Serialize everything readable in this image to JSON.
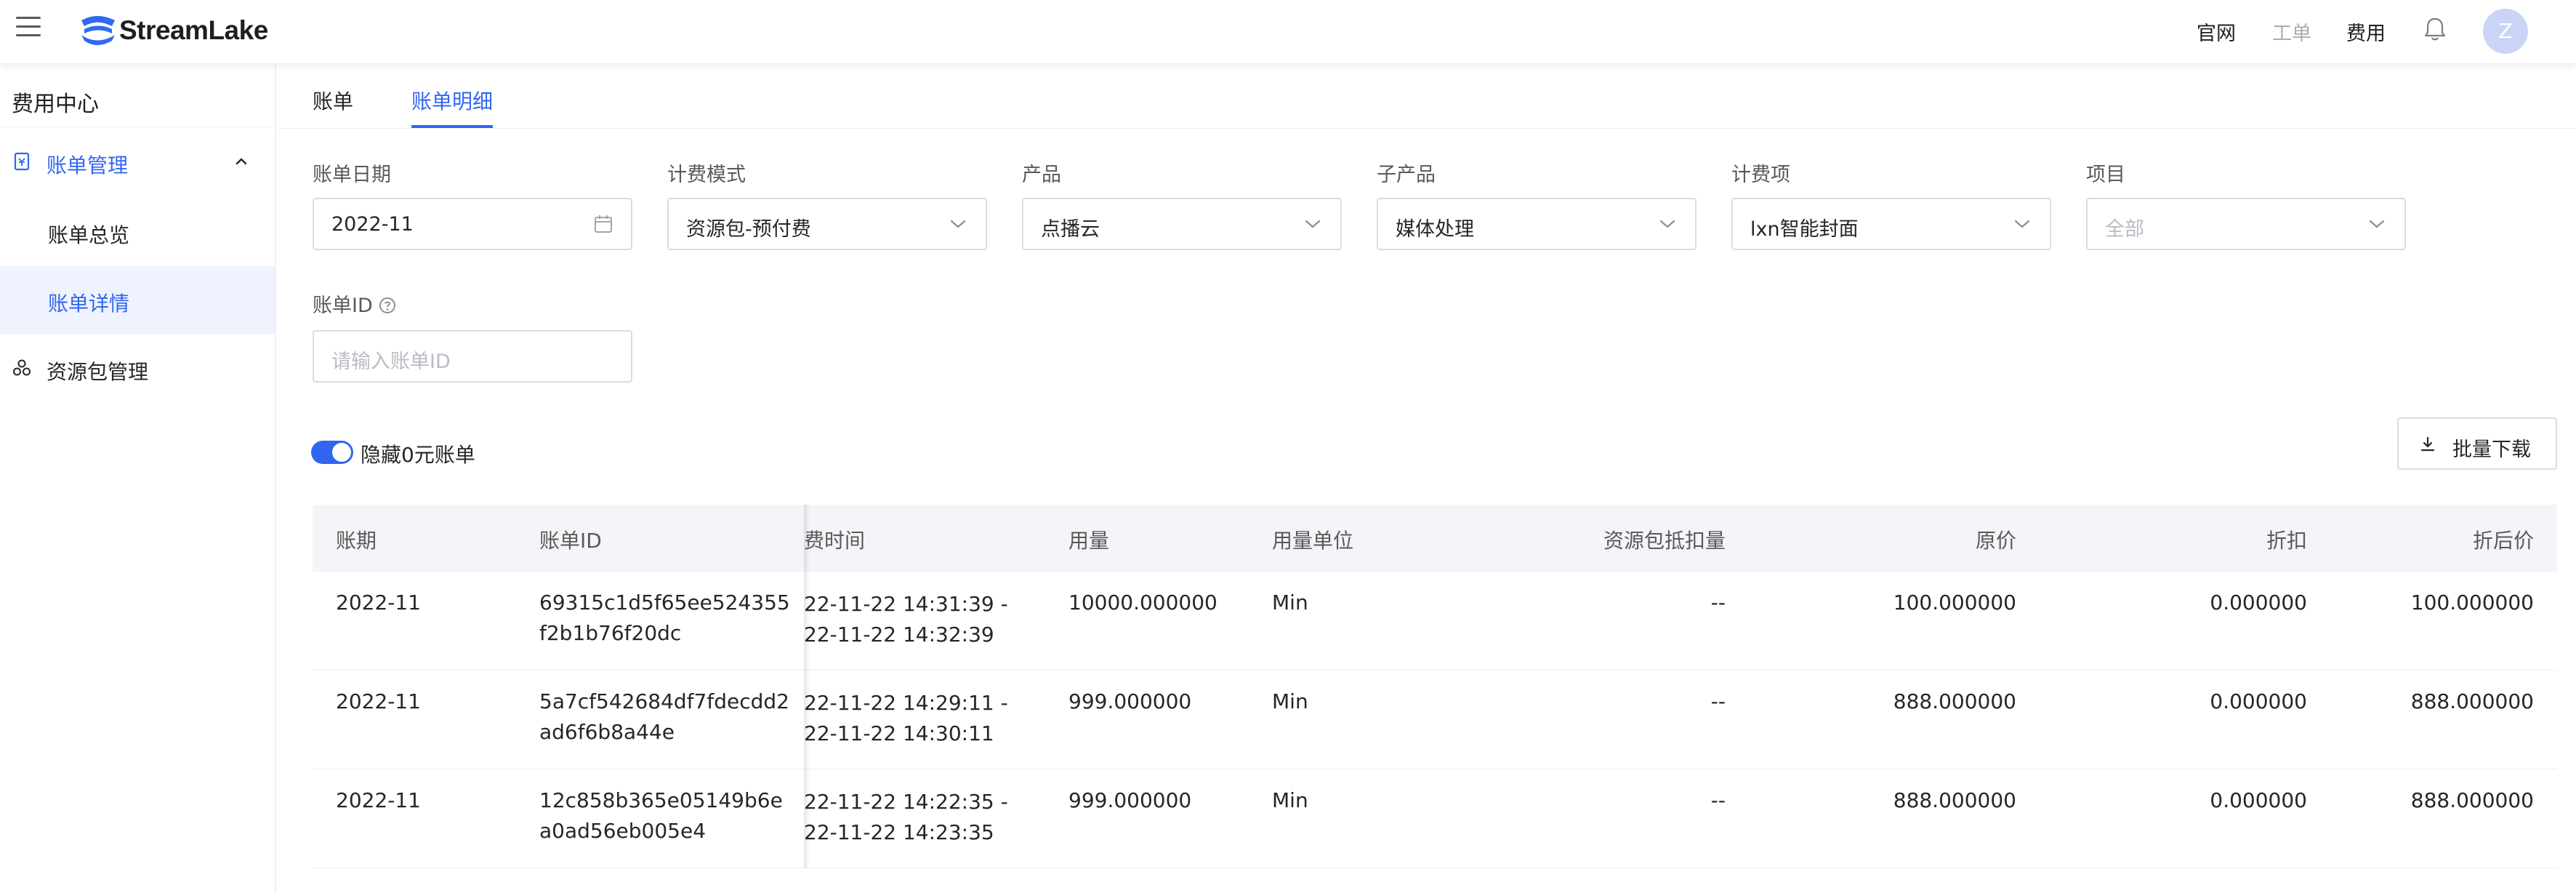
{
  "app": {
    "logo_text": "StreamLake"
  },
  "topnav": {
    "links": [
      {
        "label": "官网"
      },
      {
        "label": "工单"
      },
      {
        "label": "费用"
      }
    ],
    "avatar_letter": "Z"
  },
  "sidebar": {
    "title": "费用中心",
    "group_label": "账单管理",
    "items": [
      {
        "label": "账单总览"
      },
      {
        "label": "账单详情"
      }
    ],
    "resource_label": "资源包管理"
  },
  "tabs": [
    {
      "label": "账单"
    },
    {
      "label": "账单明细"
    }
  ],
  "filters": {
    "bill_date": {
      "label": "账单日期",
      "value": "2022-11"
    },
    "billing_mode": {
      "label": "计费模式",
      "value": "资源包-预付费"
    },
    "product": {
      "label": "产品",
      "value": "点播云"
    },
    "sub_product": {
      "label": "子产品",
      "value": "媒体处理"
    },
    "billing_item": {
      "label": "计费项",
      "value": "lxn智能封面"
    },
    "project": {
      "label": "项目",
      "placeholder": "全部"
    },
    "bill_id": {
      "label": "账单ID",
      "placeholder": "请输入账单ID"
    }
  },
  "toggle": {
    "label": "隐藏0元账单",
    "on": true
  },
  "batch_download": {
    "label": "批量下载"
  },
  "table": {
    "columns": [
      "账期",
      "账单ID",
      "费时间",
      "用量",
      "用量单位",
      "资源包抵扣量",
      "原价",
      "折扣",
      "折后价"
    ],
    "rows": [
      {
        "period": "2022-11",
        "id1": "69315c1d5f65ee524355",
        "id2": "f2b1b76f20dc",
        "time1": "22-11-22 14:31:39 -",
        "time2": "22-11-22 14:32:39",
        "usage": "10000.000000",
        "unit": "Min",
        "deduct": "--",
        "price": "100.000000",
        "discount": "0.000000",
        "final": "100.000000"
      },
      {
        "period": "2022-11",
        "id1": "5a7cf542684df7fdecdd2",
        "id2": "ad6f6b8a44e",
        "time1": "22-11-22 14:29:11 -",
        "time2": "22-11-22 14:30:11",
        "usage": "999.000000",
        "unit": "Min",
        "deduct": "--",
        "price": "888.000000",
        "discount": "0.000000",
        "final": "888.000000"
      },
      {
        "period": "2022-11",
        "id1": "12c858b365e05149b6e",
        "id2": "a0ad56eb005e4",
        "time1": "22-11-22 14:22:35 -",
        "time2": "22-11-22 14:23:35",
        "usage": "999.000000",
        "unit": "Min",
        "deduct": "--",
        "price": "888.000000",
        "discount": "0.000000",
        "final": "888.000000"
      }
    ]
  },
  "colors": {
    "accent": "#3166f2",
    "active_bg": "#eef3fe",
    "header_bg": "#f3f5f8"
  }
}
